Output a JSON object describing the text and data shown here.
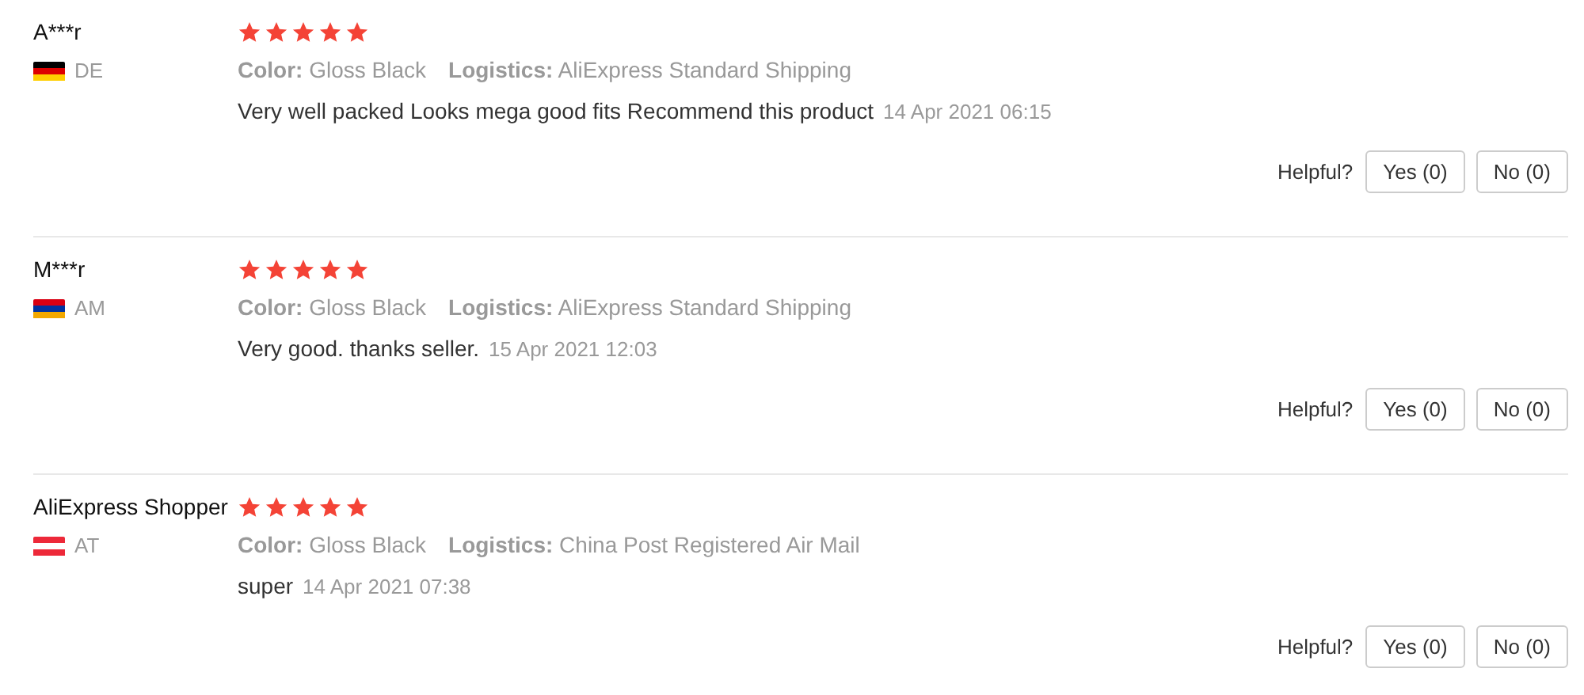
{
  "reviews": [
    {
      "name": "A***r",
      "country": "DE",
      "flag": [
        {
          "color": "#000000"
        },
        {
          "color": "#dd0000"
        },
        {
          "color": "#ffce00"
        }
      ],
      "stars": 5,
      "details": [
        {
          "label": "Color:",
          "value": "Gloss Black"
        },
        {
          "label": "Logistics:",
          "value": "AliExpress Standard Shipping"
        }
      ],
      "comment": "Very well packed Looks mega good fits Recommend this product",
      "date": "14 Apr 2021 06:15",
      "helpful_label": "Helpful?",
      "yes": "Yes (0)",
      "no": "No (0)"
    },
    {
      "name": "M***r",
      "country": "AM",
      "flag": [
        {
          "color": "#d90012"
        },
        {
          "color": "#0033a0"
        },
        {
          "color": "#f2a800"
        }
      ],
      "stars": 5,
      "details": [
        {
          "label": "Color:",
          "value": "Gloss Black"
        },
        {
          "label": "Logistics:",
          "value": "AliExpress Standard Shipping"
        }
      ],
      "comment": "Very good. thanks seller.",
      "date": "15 Apr 2021 12:03",
      "helpful_label": "Helpful?",
      "yes": "Yes (0)",
      "no": "No (0)"
    },
    {
      "name": "AliExpress Shopper",
      "country": "AT",
      "flag": [
        {
          "color": "#ed2939"
        },
        {
          "color": "#ffffff"
        },
        {
          "color": "#ed2939"
        }
      ],
      "stars": 5,
      "details": [
        {
          "label": "Color:",
          "value": "Gloss Black"
        },
        {
          "label": "Logistics:",
          "value": "China Post Registered Air Mail"
        }
      ],
      "comment": "super",
      "date": "14 Apr 2021 07:38",
      "helpful_label": "Helpful?",
      "yes": "Yes (0)",
      "no": "No (0)"
    }
  ]
}
